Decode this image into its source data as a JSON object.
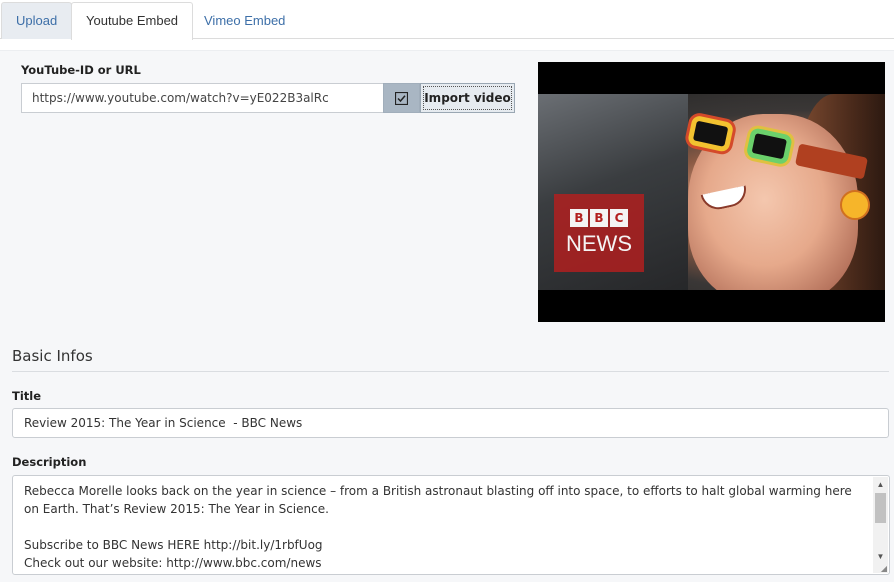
{
  "tabs": [
    {
      "label": "Upload"
    },
    {
      "label": "Youtube Embed"
    },
    {
      "label": "Vimeo Embed"
    }
  ],
  "youtube": {
    "label": "YouTube-ID or URL",
    "value": "https://www.youtube.com/watch?v=yE022B3alRc",
    "checkbox_icon": "checkbox-checked-icon",
    "import_label": "Import video"
  },
  "thumbnail": {
    "logo_blocks": [
      "B",
      "B",
      "C"
    ],
    "logo_word": "NEWS"
  },
  "basic_infos": {
    "heading": "Basic Infos",
    "title_label": "Title",
    "title_value": "Review 2015: The Year in Science  - BBC News",
    "description_label": "Description",
    "description_value": "Rebecca Morelle looks back on the year in science – from a British astronaut blasting off into space, to efforts to halt global warming here on Earth. That’s Review 2015: The Year in Science.\n\nSubscribe to BBC News HERE http://bit.ly/1rbfUog\nCheck out our website: http://www.bbc.com/news"
  },
  "colors": {
    "tab_link": "#3d6fa8",
    "addon_bg": "#a9b6c3",
    "bbc_red": "#b41e1e"
  }
}
